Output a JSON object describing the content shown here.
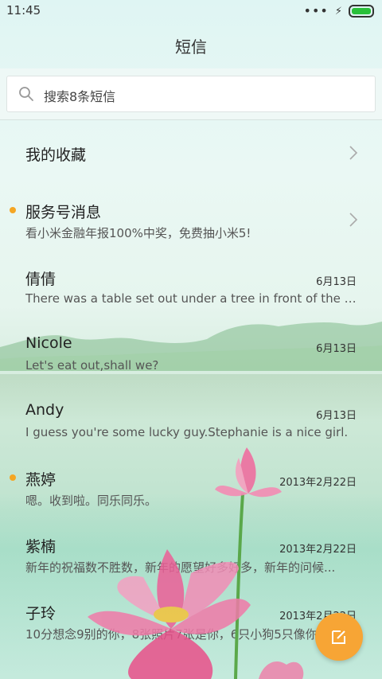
{
  "status_bar": {
    "time": "11:45",
    "more_dots": "•••",
    "charging": "⚡"
  },
  "header": {
    "title": "短信"
  },
  "search": {
    "placeholder": "搜索8条短信"
  },
  "conversations": [
    {
      "name": "我的收藏",
      "date": "",
      "preview": "",
      "unread": false,
      "chevron": true
    },
    {
      "name": "服务号消息",
      "date": "",
      "preview": "看小米金融年报100%中奖，免费抽小米5!",
      "unread": true,
      "chevron": true
    },
    {
      "name": "倩倩",
      "date": "6月13日",
      "preview": "There was a table set out under a tree in front of the ho...",
      "unread": false,
      "chevron": false
    },
    {
      "name": "Nicole",
      "date": "6月13日",
      "preview": "Let's eat out,shall we?",
      "unread": false,
      "chevron": false
    },
    {
      "name": "Andy",
      "date": "6月13日",
      "preview": "I guess you're some lucky guy.Stephanie is a nice girl.",
      "unread": false,
      "chevron": false
    },
    {
      "name": "燕婷",
      "date": "2013年2月22日",
      "preview": "嗯。收到啦。同乐同乐。",
      "unread": true,
      "chevron": false
    },
    {
      "name": "紫楠",
      "date": "2013年2月22日",
      "preview": "新年的祝福数不胜数，新年的愿望好多好多，新年的问候...",
      "unread": false,
      "chevron": false
    },
    {
      "name": "子玲",
      "date": "2013年2月22日",
      "preview": "10分想念9别的你，8张照片7张是你，6只小狗5只像你...",
      "unread": false,
      "chevron": false
    }
  ],
  "colors": {
    "unread_dot": "#f5a623",
    "fab": "#f7a535",
    "battery": "#29c03a"
  },
  "icons": {
    "search": "search-icon",
    "compose": "compose-icon",
    "chevron": "chevron-right-icon"
  }
}
